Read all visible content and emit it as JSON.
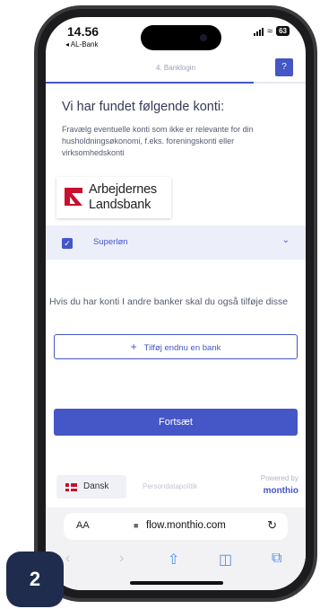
{
  "status_bar": {
    "time": "14.56",
    "back_app": "◂ AL-Bank",
    "battery": "63"
  },
  "header": {
    "step_label": "4. Banklogin",
    "help_label": "?",
    "progress_fraction": 0.8
  },
  "main": {
    "heading": "Vi har fundet følgende konti:",
    "description": "Fravælg eventuelle konti som ikke er relevante for din husholdningsøkonomi, f.eks. foreningskonti eller virksomhedskonti",
    "bank": {
      "name_line1": "Arbejdernes",
      "name_line2": "Landsbank",
      "brand_color": "#c8102e"
    },
    "account": {
      "name": "Superløn",
      "checked": true
    },
    "other_banks_text": "Hvis du har konti I andre banker skal du også tilføje disse",
    "add_bank_label": "Tilføj endnu en bank",
    "continue_label": "Fortsæt"
  },
  "footer": {
    "language": "Dansk",
    "privacy_label": "Persondatapolitik",
    "powered_by": "Powered by",
    "brand": "monthio"
  },
  "browser": {
    "aa_label": "AA",
    "url": "flow.monthio.com",
    "icons": [
      "back-icon",
      "forward-icon",
      "share-icon",
      "bookmarks-icon",
      "tabs-icon"
    ]
  },
  "step_badge": "2",
  "colors": {
    "accent": "#4556c6",
    "badge": "#1f2c4e"
  }
}
